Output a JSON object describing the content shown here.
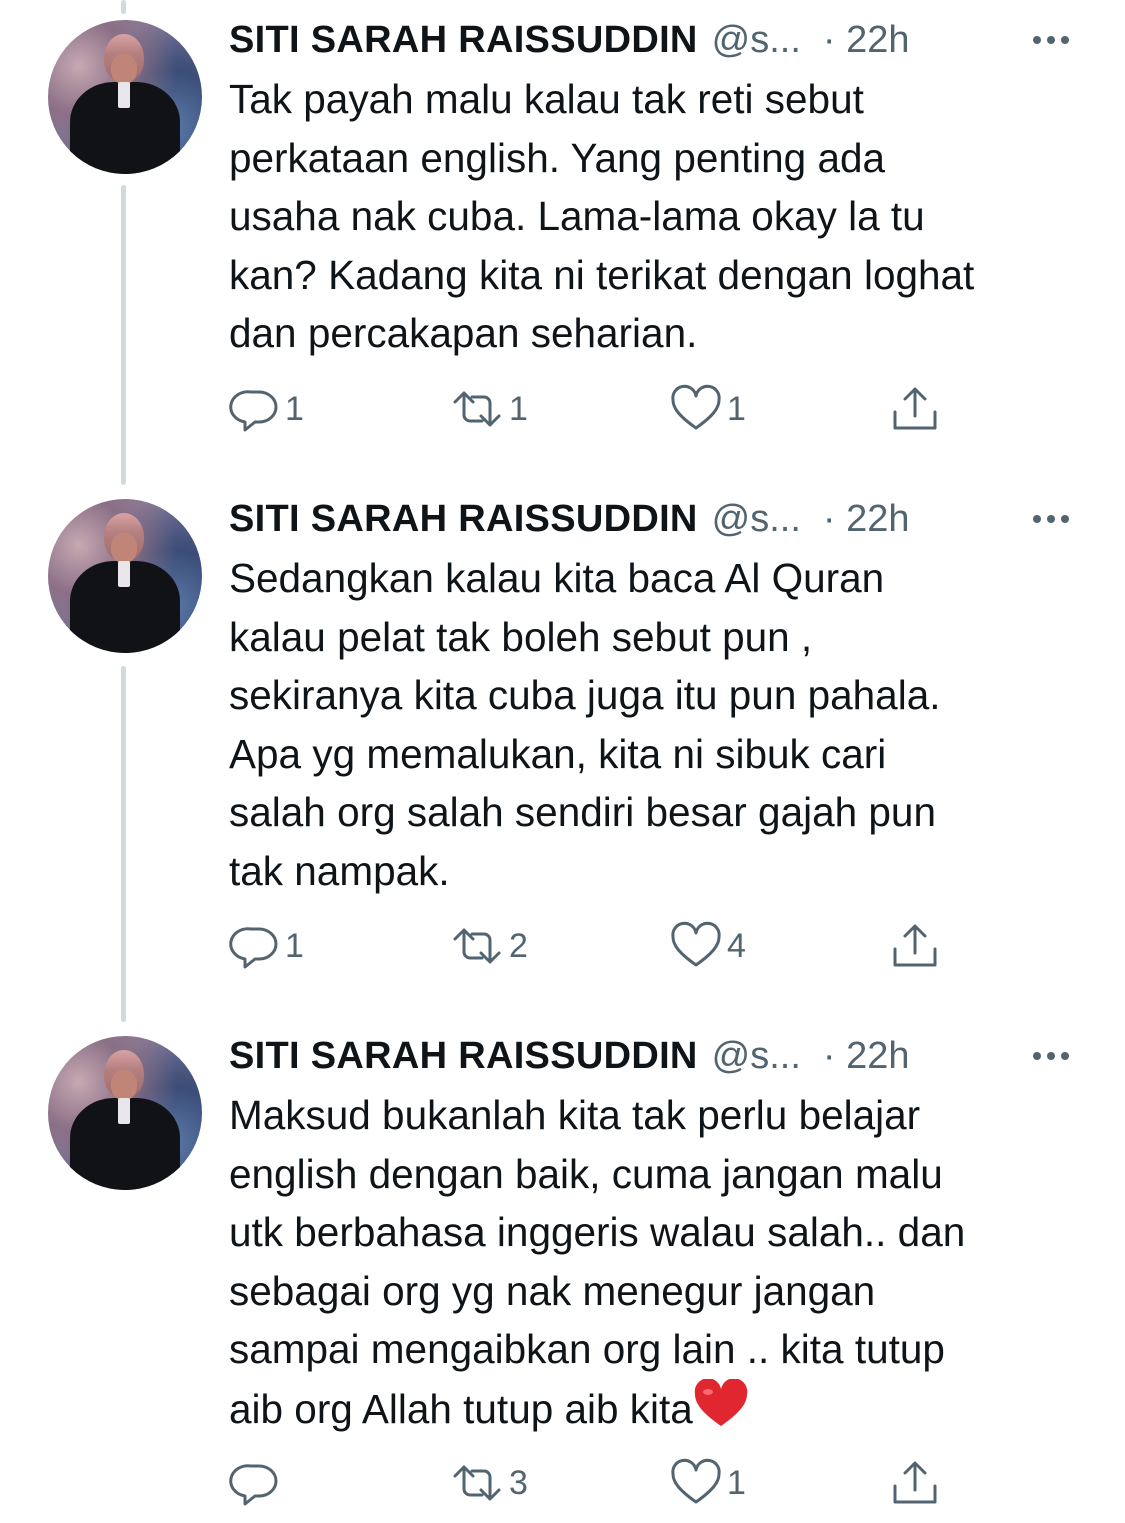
{
  "tweets": [
    {
      "name": "SITI SARAH RAISSUDDIN",
      "handle": "@s...",
      "time": "· 22h",
      "text": "Tak payah malu kalau tak reti sebut\nperkataan english. Yang penting ada\nusaha nak cuba. Lama-lama okay la tu\nkan? Kadang kita ni terikat dengan loghat\ndan percakapan seharian.",
      "replies": "1",
      "retweets": "1",
      "likes": "1"
    },
    {
      "name": "SITI SARAH RAISSUDDIN",
      "handle": "@s...",
      "time": "· 22h",
      "text": "Sedangkan kalau kita baca Al Quran\nkalau pelat tak boleh sebut pun  ,\nsekiranya kita cuba juga itu pun pahala.\nApa yg memalukan, kita ni sibuk cari\nsalah org salah sendiri besar gajah pun\ntak nampak.",
      "replies": "1",
      "retweets": "2",
      "likes": "4"
    },
    {
      "name": "SITI SARAH RAISSUDDIN",
      "handle": "@s...",
      "time": "· 22h",
      "text": "Maksud bukanlah kita tak perlu belajar\nenglish dengan baik, cuma jangan malu\nutk berbahasa inggeris walau salah.. dan\nsebagai org yg nak menegur jangan\nsampai mengaibkan org lain .. kita tutup\naib org  Allah tutup aib kita",
      "replies": "",
      "retweets": "3",
      "likes": "1",
      "emoji": "red-heart"
    }
  ],
  "icons": {
    "reply": "reply-icon",
    "retweet": "retweet-icon",
    "like": "heart-icon",
    "share": "share-icon",
    "more": "more-icon"
  },
  "colors": {
    "text": "#0f1419",
    "muted": "#536471",
    "thread_line": "#cfd9de",
    "heart_emoji": "#e0262f"
  }
}
